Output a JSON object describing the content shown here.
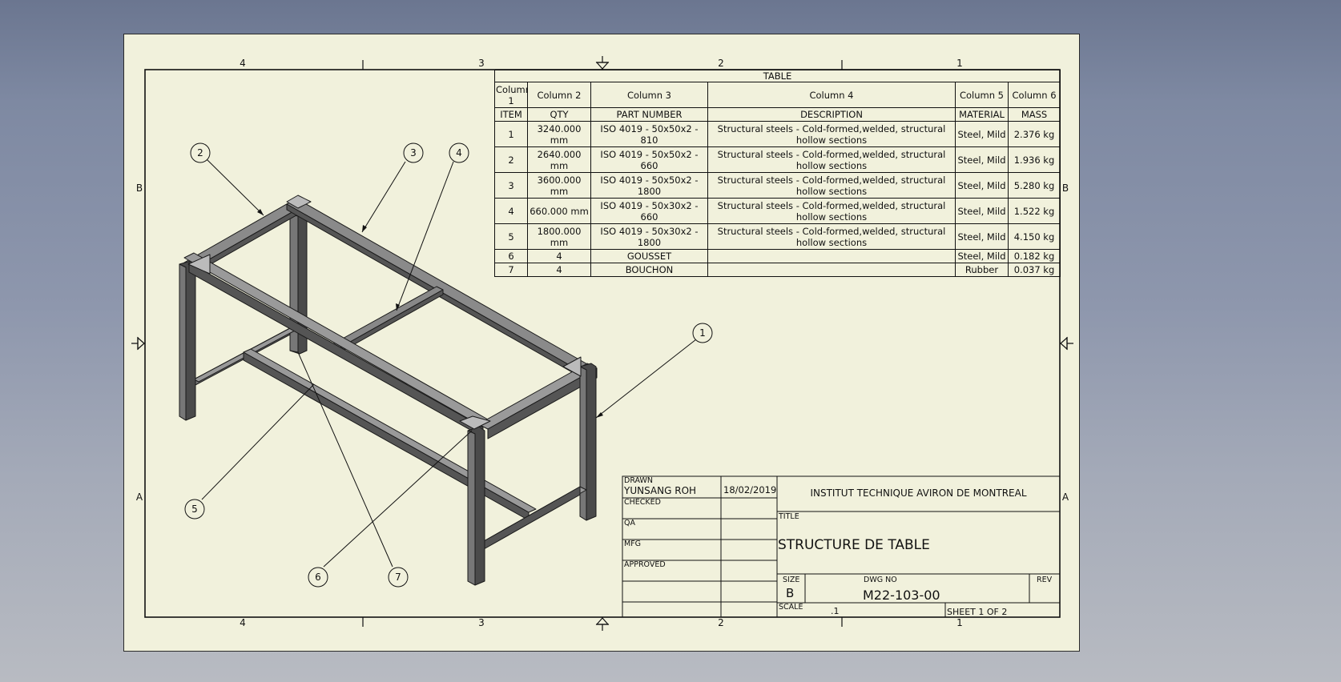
{
  "sheet": {
    "zone_cols_top": [
      "4",
      "3",
      "2",
      "1"
    ],
    "zone_cols_bottom": [
      "4",
      "3",
      "2",
      "1"
    ],
    "zone_rows_left": [
      "B",
      "A"
    ],
    "zone_rows_right": [
      "B",
      "A"
    ]
  },
  "balloons": [
    "1",
    "2",
    "3",
    "4",
    "5",
    "6",
    "7"
  ],
  "bom": {
    "title": "TABLE",
    "headers": [
      "Column 1",
      "Column 2",
      "Column 3",
      "Column 4",
      "Column 5",
      "Column 6"
    ],
    "subheaders": [
      "ITEM",
      "QTY",
      "PART NUMBER",
      "DESCRIPTION",
      "MATERIAL",
      "MASS"
    ],
    "rows": [
      [
        "1",
        "3240.000 mm",
        "ISO 4019 - 50x50x2 - 810",
        "Structural steels - Cold-formed,welded, structural hollow sections",
        "Steel, Mild",
        "2.376 kg"
      ],
      [
        "2",
        "2640.000 mm",
        "ISO 4019 - 50x50x2 - 660",
        "Structural steels - Cold-formed,welded, structural hollow sections",
        "Steel, Mild",
        "1.936 kg"
      ],
      [
        "3",
        "3600.000 mm",
        "ISO 4019 - 50x50x2 - 1800",
        "Structural steels - Cold-formed,welded, structural hollow sections",
        "Steel, Mild",
        "5.280 kg"
      ],
      [
        "4",
        "660.000 mm",
        "ISO 4019 - 50x30x2 - 660",
        "Structural steels - Cold-formed,welded, structural hollow sections",
        "Steel, Mild",
        "1.522 kg"
      ],
      [
        "5",
        "1800.000 mm",
        "ISO 4019 - 50x30x2 - 1800",
        "Structural steels - Cold-formed,welded, structural hollow sections",
        "Steel, Mild",
        "4.150 kg"
      ],
      [
        "6",
        "4",
        "GOUSSET",
        "",
        "Steel, Mild",
        "0.182 kg"
      ],
      [
        "7",
        "4",
        "BOUCHON",
        "",
        "Rubber",
        "0.037 kg"
      ]
    ]
  },
  "title_block": {
    "drawn_label": "DRAWN",
    "drawn_by": "YUNSANG ROH",
    "drawn_date": "18/02/2019",
    "checked_label": "CHECKED",
    "qa_label": "QA",
    "mfg_label": "MFG",
    "approved_label": "APPROVED",
    "company": "INSTITUT TECHNIQUE AVIRON DE MONTREAL",
    "title_label": "TITLE",
    "title": "STRUCTURE DE TABLE",
    "size_label": "SIZE",
    "size": "B",
    "dwg_no_label": "DWG NO",
    "dwg_no": "M22-103-00",
    "rev_label": "REV",
    "scale_label": "SCALE",
    "scale": ".1",
    "sheet_label": "SHEET 1  OF 2"
  }
}
